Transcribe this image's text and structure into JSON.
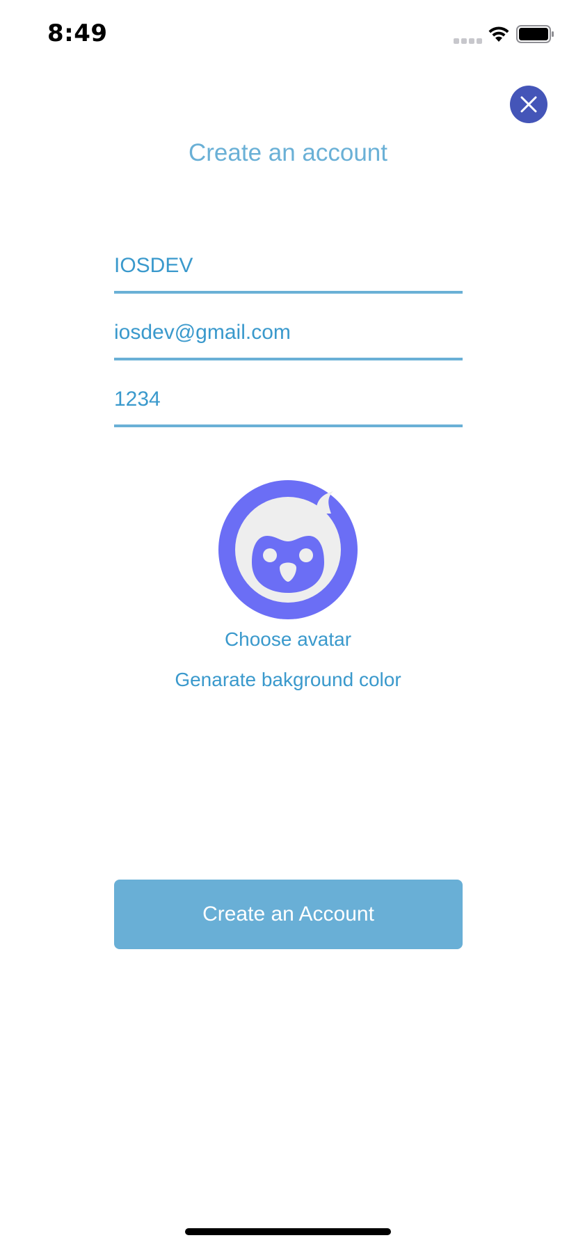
{
  "status_bar": {
    "time": "8:49",
    "icons": [
      "signal-icon",
      "wifi-icon",
      "battery-icon"
    ]
  },
  "header": {
    "title": "Create an account",
    "close_icon": "close-icon"
  },
  "form": {
    "username": {
      "value": "IOSDEV",
      "placeholder": ""
    },
    "email": {
      "value": "iosdev@gmail.com",
      "placeholder": ""
    },
    "password": {
      "value": "1234",
      "placeholder": ""
    }
  },
  "avatar": {
    "icon": "penguin-avatar-icon",
    "background_color": "#6b6ef5",
    "choose_label": "Choose avatar",
    "generate_bg_label": "Genarate bakground color"
  },
  "actions": {
    "create_label": "Create an Account"
  },
  "colors": {
    "accent": "#6ab0d6",
    "link": "#3a99cc",
    "close_button": "#4455b8",
    "button": "#69afd6"
  }
}
